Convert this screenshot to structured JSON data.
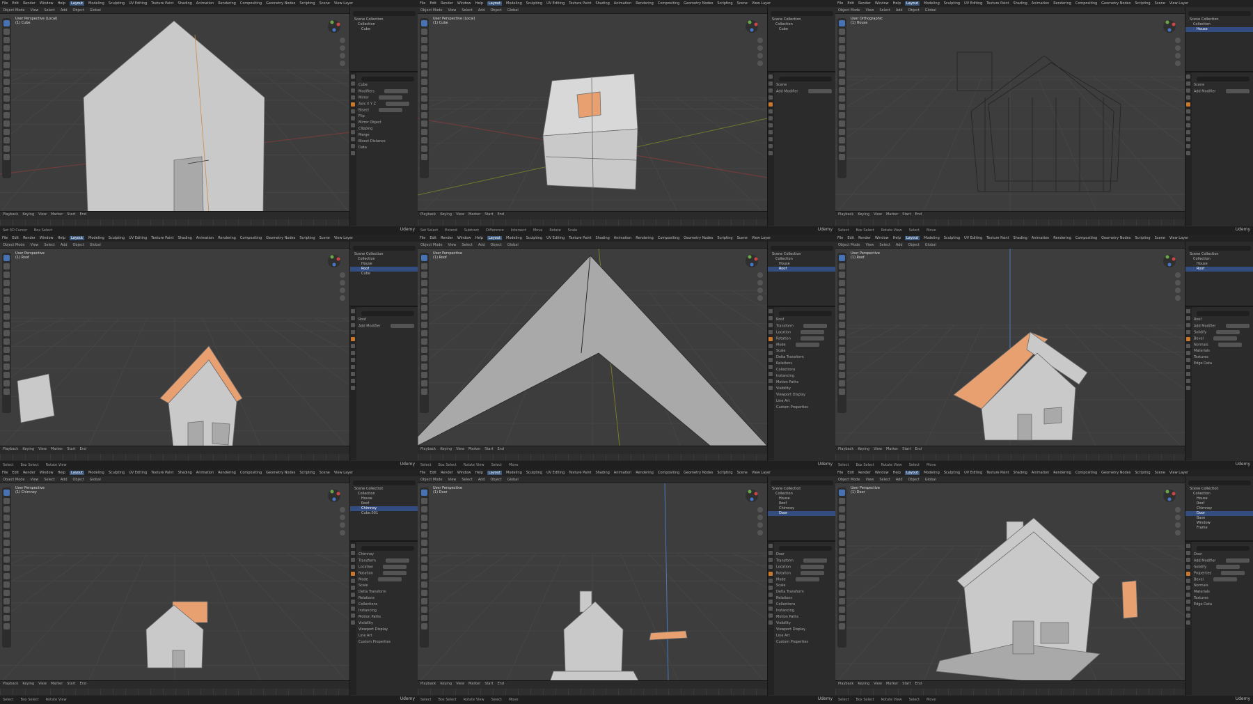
{
  "app": {
    "menu": [
      "File",
      "Edit",
      "Render",
      "Window",
      "Help"
    ],
    "workspace_tabs": [
      "Layout",
      "Modeling",
      "Sculpting",
      "UV Editing",
      "Texture Paint",
      "Shading",
      "Animation",
      "Rendering",
      "Compositing",
      "Geometry Nodes",
      "Scripting"
    ],
    "active_workspace": "Layout",
    "scene": "Scene",
    "view_layer": "View Layer",
    "watermark": "Udemy",
    "accent_color": "#4772b3",
    "selection_color": "#e8a070"
  },
  "header": {
    "mode": "Object Mode",
    "menus": [
      "View",
      "Select",
      "Add",
      "Object"
    ],
    "orientation": "Global"
  },
  "timeline": {
    "items": [
      "Playback",
      "Keying",
      "View",
      "Marker"
    ],
    "start_label": "Start",
    "end_label": "End"
  },
  "cells": [
    {
      "vp_title": "User Perspective (Local)",
      "vp_sub": "(1) Cube",
      "status": [
        "Set 3D Cursor",
        "Box Select"
      ],
      "outliner": [
        "Scene Collection",
        "Collection",
        "Cube"
      ],
      "outliner_sel": -1,
      "props": [
        "Cube",
        "Modifiers",
        "Mirror",
        "Axis  X Y Z",
        "Bisect",
        "Flip",
        "Mirror Object",
        "Clipping",
        "Merge",
        "Bisect Distance",
        "Data"
      ]
    },
    {
      "vp_title": "User Perspective (Local)",
      "vp_sub": "(1) Cube",
      "status": [
        "Set Select",
        "Extend",
        "Subtract",
        "Difference",
        "Intersect",
        "Move",
        "Rotate",
        "Scale"
      ],
      "outliner": [
        "Scene Collection",
        "Collection",
        "Cube"
      ],
      "outliner_sel": -1,
      "props": [
        "Scene",
        "Add Modifier"
      ]
    },
    {
      "vp_title": "User Orthographic",
      "vp_sub": "(1) House",
      "status": [
        "Select",
        "Box Select",
        "Rotate View",
        "Select",
        "Move"
      ],
      "outliner": [
        "Scene Collection",
        "Collection",
        "House"
      ],
      "outliner_sel": 2,
      "props": [
        "Scene",
        "Add Modifier"
      ]
    },
    {
      "vp_title": "User Perspective",
      "vp_sub": "(1) Roof",
      "status": [
        "Select",
        "Box Select",
        "Rotate View"
      ],
      "outliner": [
        "Scene Collection",
        "Collection",
        "House",
        "Roof",
        "Cube"
      ],
      "outliner_sel": 3,
      "props": [
        "Roof",
        "Add Modifier"
      ]
    },
    {
      "vp_title": "User Perspective",
      "vp_sub": "(1) Roof",
      "status": [
        "Select",
        "Box Select",
        "Rotate View",
        "Select",
        "Move"
      ],
      "outliner": [
        "Scene Collection",
        "Collection",
        "House",
        "Roof"
      ],
      "outliner_sel": 3,
      "props": [
        "Roof",
        "Transform",
        "Location",
        "Rotation",
        "Mode",
        "Scale",
        "Delta Transform",
        "Relations",
        "Collections",
        "Instancing",
        "Motion Paths",
        "Visibility",
        "Viewport Display",
        "Line Art",
        "Custom Properties"
      ]
    },
    {
      "vp_title": "User Perspective",
      "vp_sub": "(1) Roof",
      "status": [
        "Select",
        "Box Select",
        "Rotate View",
        "Select",
        "Move"
      ],
      "outliner": [
        "Scene Collection",
        "Collection",
        "House",
        "Roof"
      ],
      "outliner_sel": 3,
      "props": [
        "Roof",
        "Add Modifier",
        "Solidify",
        "Bevel",
        "Normals",
        "Materials",
        "Textures",
        "Edge Data"
      ]
    },
    {
      "vp_title": "User Perspective",
      "vp_sub": "(1) Chimney",
      "status": [
        "Select",
        "Box Select",
        "Rotate View"
      ],
      "outliner": [
        "Scene Collection",
        "Collection",
        "House",
        "Roof",
        "Chimney",
        "Cube.001"
      ],
      "outliner_sel": 4,
      "props": [
        "Chimney",
        "Transform",
        "Location",
        "Rotation",
        "Mode",
        "Scale",
        "Delta Transform",
        "Relations",
        "Collections",
        "Instancing",
        "Motion Paths",
        "Visibility",
        "Viewport Display",
        "Line Art",
        "Custom Properties"
      ]
    },
    {
      "vp_title": "User Perspective",
      "vp_sub": "(1) Door",
      "status": [
        "Select",
        "Box Select",
        "Rotate View",
        "Select",
        "Move"
      ],
      "outliner": [
        "Scene Collection",
        "Collection",
        "House",
        "Roof",
        "Chimney",
        "Door"
      ],
      "outliner_sel": 5,
      "props": [
        "Door",
        "Transform",
        "Location",
        "Rotation",
        "Mode",
        "Scale",
        "Delta Transform",
        "Relations",
        "Collections",
        "Instancing",
        "Motion Paths",
        "Visibility",
        "Viewport Display",
        "Line Art",
        "Custom Properties"
      ]
    },
    {
      "vp_title": "User Perspective",
      "vp_sub": "(1) Door",
      "status": [
        "Select",
        "Box Select",
        "Rotate View",
        "Select",
        "Move"
      ],
      "outliner": [
        "Scene Collection",
        "Collection",
        "House",
        "Roof",
        "Chimney",
        "Door",
        "Base",
        "Window",
        "Frame"
      ],
      "outliner_sel": 5,
      "props": [
        "Door",
        "Add Modifier",
        "Solidify",
        "Properties",
        "Bevel",
        "Normals",
        "Materials",
        "Textures",
        "Edge Data"
      ]
    }
  ]
}
